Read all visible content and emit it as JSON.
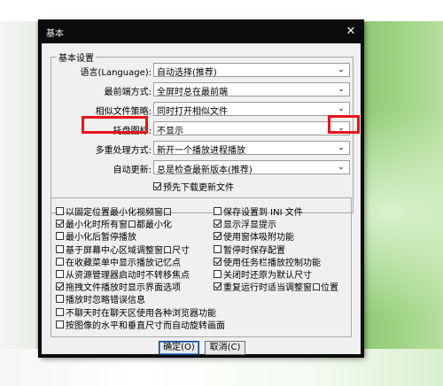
{
  "dialog": {
    "title": "基本",
    "close_glyph": "✕"
  },
  "basic": {
    "legend": "基本设置",
    "language": {
      "label": "语言(Language):",
      "value": "自动选择(推荐)"
    },
    "topmost": {
      "label": "最前端方式:",
      "value": "全屏时总在最前端"
    },
    "similar": {
      "label": "相似文件策略:",
      "value": "同时打开相似文件"
    },
    "tray": {
      "label": "托盘图标:",
      "value": "不显示"
    },
    "multi": {
      "label": "多重处理方式:",
      "value": "新开一个播放进程播放"
    },
    "update": {
      "label": "自动更新:",
      "value": "总是检查最新版本(推荐)"
    },
    "predownload": {
      "label": "预先下载更新文件",
      "checked": true
    }
  },
  "options": {
    "left": [
      {
        "label": "以固定位置最小化视频窗口",
        "checked": false
      },
      {
        "label": "最小化时所有窗口都最小化",
        "checked": true
      },
      {
        "label": "最小化后暂停播放",
        "checked": false
      },
      {
        "label": "基于屏幕中心区域调整窗口尺寸",
        "checked": false
      },
      {
        "label": "在收藏菜单中显示播放记忆点",
        "checked": false
      },
      {
        "label": "从资源管理器启动时不转移焦点",
        "checked": false
      },
      {
        "label": "拖拽文件播放时显示界面选项",
        "checked": true
      },
      {
        "label": "播放时忽略错误信息",
        "checked": false
      },
      {
        "label": "不聊天时在聊天区使用各种浏览器功能",
        "checked": false
      },
      {
        "label": "按图像的水平和垂直尺寸而自动旋转画面",
        "checked": false
      }
    ],
    "right": [
      {
        "label": "保存设置到 INI 文件",
        "checked": false
      },
      {
        "label": "显示浮显提示",
        "checked": true
      },
      {
        "label": "使用窗体吸附功能",
        "checked": true
      },
      {
        "label": "暂停时保存配置",
        "checked": false
      },
      {
        "label": "使用任务栏播放控制功能",
        "checked": true
      },
      {
        "label": "关闭时还原为默认尺寸",
        "checked": false
      },
      {
        "label": "重复运行时适当调整窗口位置",
        "checked": true
      }
    ]
  },
  "buttons": {
    "ok": "确定(O)",
    "cancel": "取消(C)"
  },
  "colors": {
    "highlight": "#e8141a",
    "dialog_frame": "#0c0c0c",
    "client": "#f0f0f0"
  }
}
